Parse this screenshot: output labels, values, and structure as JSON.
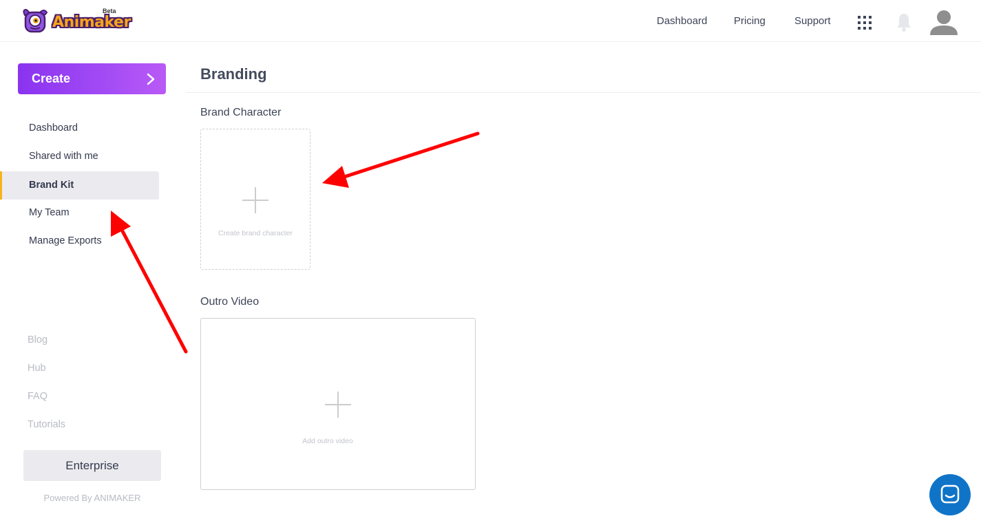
{
  "brand": {
    "name": "Animaker",
    "tag": "Beta"
  },
  "nav": {
    "dashboard": "Dashboard",
    "pricing": "Pricing",
    "support": "Support"
  },
  "icons": {
    "apps": "apps-grid-icon",
    "notifications": "bell-icon",
    "profile": "user-avatar-icon",
    "chat": "chat-icon"
  },
  "sidebar": {
    "create_label": "Create",
    "items": [
      {
        "label": "Dashboard",
        "active": false
      },
      {
        "label": "Shared with me",
        "active": false
      },
      {
        "label": "Brand Kit",
        "active": true
      },
      {
        "label": "My Team",
        "active": false
      },
      {
        "label": "Manage Exports",
        "active": false
      }
    ],
    "links": [
      "Blog",
      "Hub",
      "FAQ",
      "Tutorials"
    ],
    "enterprise_label": "Enterprise",
    "powered_by": "Powered By ANIMAKER"
  },
  "main": {
    "title": "Branding",
    "brand_character": {
      "label": "Brand Character",
      "caption": "Create brand character"
    },
    "outro_video": {
      "label": "Outro Video",
      "caption": "Add outro video"
    }
  },
  "colors": {
    "accent_purple": "#8a33f0",
    "active_marker": "#f6b31b",
    "annotation_arrow": "#ff0000",
    "chat_blue": "#0f74c8"
  }
}
